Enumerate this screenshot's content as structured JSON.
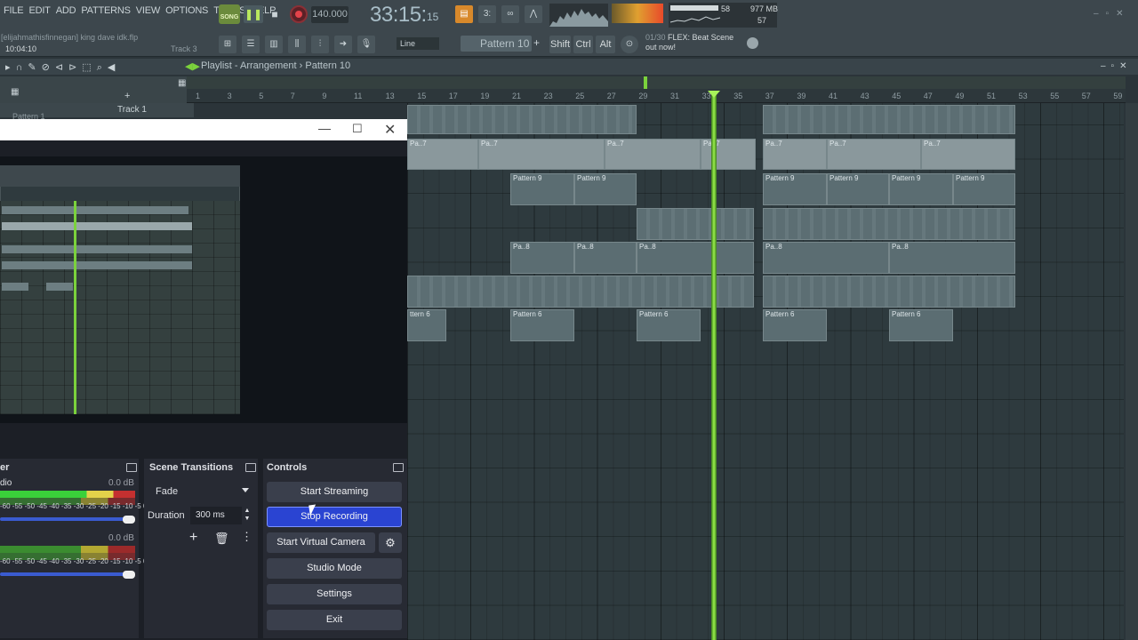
{
  "fl": {
    "menu": [
      "FILE",
      "EDIT",
      "ADD",
      "PATTERNS",
      "VIEW",
      "OPTIONS",
      "TOOLS",
      "HELP"
    ],
    "song_label": "SONG",
    "tempo": "140.000",
    "time_main": "33:15:",
    "time_ms": "15",
    "hint_user": "[elijahmathisfinnegan] king dave idk.flp",
    "hint_time": "10:04:10",
    "hint_track": "Track 3",
    "cpu_value": "58",
    "memory": "977 MB",
    "polyphony": "57",
    "snap": "Line",
    "pattern": "Pattern 10",
    "keys": [
      "Shift",
      "Ctrl",
      "Alt"
    ],
    "news_count": "01/30",
    "news_text": "FLEX: Beat Scene",
    "news_text2": "out now!"
  },
  "playlist": {
    "title": "Playlist - Arrangement › Pattern 10",
    "track1": "Track 1",
    "pattern1": "Pattern 1",
    "ruler": [
      "1",
      "3",
      "5",
      "7",
      "9",
      "11",
      "13",
      "15",
      "17",
      "19",
      "21",
      "23",
      "25",
      "27",
      "29",
      "31",
      "33",
      "35",
      "37",
      "39",
      "41",
      "43",
      "45",
      "47",
      "49",
      "51",
      "53",
      "55",
      "57",
      "59"
    ],
    "clips": {
      "pa7": "Pa..7",
      "pa8": "Pa..8",
      "pattern9": "Pattern 9",
      "pattern6": "Pattern 6",
      "ttern6": "ttern 6"
    }
  },
  "obs": {
    "mixer": {
      "title": "er",
      "ch1_name": "dio",
      "ch1_db": "0.0 dB",
      "ch2_db": "0.0 dB",
      "scale": "-60 -55 -50 -45 -40 -35 -30 -25 -20 -15 -10 -5 0"
    },
    "transitions": {
      "title": "Scene Transitions",
      "type": "Fade",
      "duration_label": "Duration",
      "duration_value": "300 ms"
    },
    "controls": {
      "title": "Controls",
      "start_streaming": "Start Streaming",
      "stop_recording": "Stop Recording",
      "start_virtual_camera": "Start Virtual Camera",
      "studio_mode": "Studio Mode",
      "settings": "Settings",
      "exit": "Exit"
    }
  },
  "colors": {
    "accent_active": "#2a44d2",
    "playhead": "#9af04c",
    "record": "#e3434a"
  }
}
